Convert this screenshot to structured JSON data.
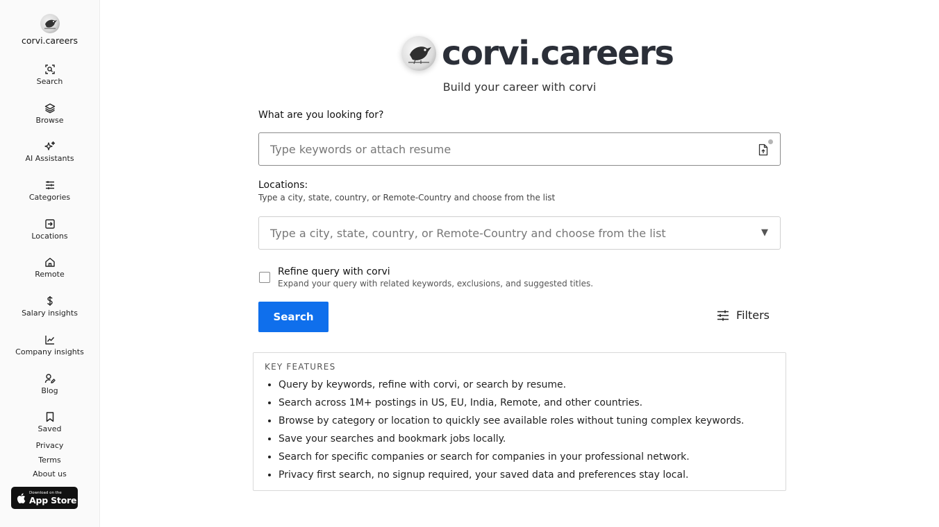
{
  "brand": {
    "name": "corvi.careers",
    "logo_icon": "crow-logo"
  },
  "nav": [
    {
      "label": "Search",
      "icon": "search-icon"
    },
    {
      "label": "Browse",
      "icon": "layers-icon"
    },
    {
      "label": "AI Assistants",
      "icon": "sparkles-icon"
    },
    {
      "label": "Categories",
      "icon": "sliders-icon"
    },
    {
      "label": "Locations",
      "icon": "enter-icon"
    },
    {
      "label": "Remote",
      "icon": "home-icon"
    },
    {
      "label": "Salary insights",
      "icon": "dollar-icon"
    },
    {
      "label": "Company insights",
      "icon": "chart-line-icon"
    },
    {
      "label": "Blog",
      "icon": "user-pen-icon"
    },
    {
      "label": "Saved",
      "icon": "bookmark-icon"
    }
  ],
  "footer": {
    "privacy": "Privacy",
    "terms": "Terms",
    "about": "About us"
  },
  "appstore": {
    "small": "Download on the",
    "big": "App Store"
  },
  "hero": {
    "title": "corvi.careers",
    "tagline": "Build your career with corvi"
  },
  "form": {
    "query_label": "What are you looking for?",
    "query_placeholder": "Type keywords or attach resume",
    "locations_label": "Locations:",
    "locations_hint": "Type a city, state, country, or Remote-Country and choose from the list",
    "locations_placeholder": "Type a city, state, country, or Remote-Country and choose from the list",
    "refine_title": "Refine query with corvi",
    "refine_sub": "Expand your query with related keywords, exclusions, and suggested titles.",
    "refine_checked": false,
    "search_button": "Search",
    "filters_label": "Filters"
  },
  "features": {
    "title": "Key Features",
    "items": [
      "Query by keywords, refine with corvi, or search by resume.",
      "Search across 1M+ postings in US, EU, India, Remote, and other countries.",
      "Browse by category or location to quickly see available roles without tuning complex keywords.",
      "Save your searches and bookmark jobs locally.",
      "Search for specific companies or search for companies in your professional network.",
      "Privacy first search, no signup required, your saved data and preferences stay local."
    ]
  },
  "colors": {
    "accent": "#0f6fec",
    "text": "#2b2f38",
    "sidebar_bg": "#fafafa"
  }
}
